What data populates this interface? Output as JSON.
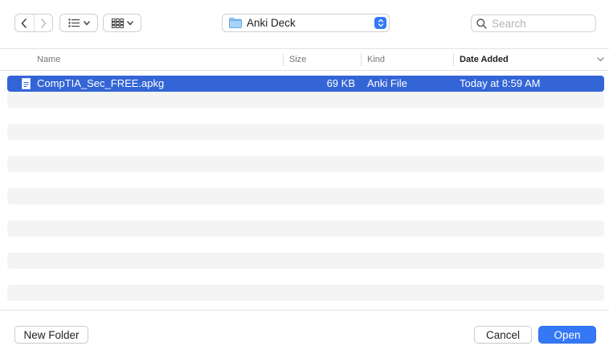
{
  "toolbar": {
    "location": "Anki Deck",
    "search_placeholder": "Search"
  },
  "columns": {
    "name": "Name",
    "size": "Size",
    "kind": "Kind",
    "date_added": "Date Added"
  },
  "files": [
    {
      "name": "CompTIA_Sec_FREE.apkg",
      "size": "69 KB",
      "kind": "Anki File",
      "date_added": "Today at 8:59 AM",
      "selected": true
    }
  ],
  "buttons": {
    "new_folder": "New Folder",
    "cancel": "Cancel",
    "open": "Open"
  },
  "colors": {
    "accent": "#3478f6",
    "selection": "#3465d6",
    "alt_row": "#f4f4f4"
  }
}
